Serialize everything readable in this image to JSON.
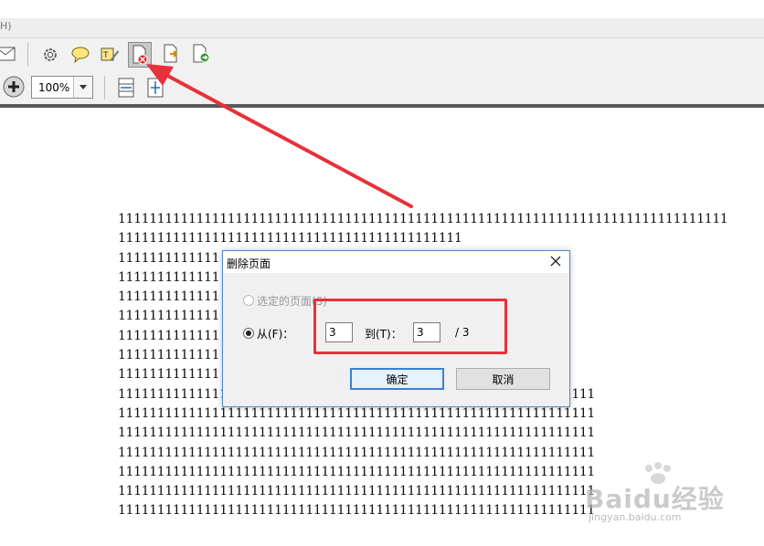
{
  "menubar": {
    "fragment": "H)"
  },
  "toolbar": {
    "zoom_value": "100%",
    "icons": [
      "mail-icon",
      "gear-icon",
      "comment-icon",
      "sign-icon",
      "delete-page-icon",
      "export-icon",
      "extract-icon",
      "zoom-in-icon",
      "fit-width-icon",
      "fit-page-icon"
    ]
  },
  "document": {
    "lines": [
      "111111111111111111111111111111111111111111111111111111111111111111111111111111",
      "11111111111111111111111111111111111111111111",
      "1111111111111",
      "1111111111111",
      "1111111111111",
      "1111111111111",
      "1111111111111",
      "1111111111111",
      "1111111111111",
      "1111111111111111111111111111111111111111111111111111111111111",
      "1111111111111111111111111111111111111111111111111111111111111",
      "1111111111111111111111111111111111111111111111111111111111111",
      "1111111111111111111111111111111111111111111111111111111111111",
      "1111111111111111111111111111111111111111111111111111111111111",
      "1111111111111111111111111111111111111111111111111111111111111",
      "1111111111111111111111111111111111111111111111111111111111111"
    ]
  },
  "dialog": {
    "title": "删除页面",
    "option_selected": "选定的页面(S)",
    "option_from": "从(F)：",
    "from_value": "3",
    "to_label": "到(T)：",
    "to_value": "3",
    "total": "/ 3",
    "ok_label": "确定",
    "cancel_label": "取消"
  },
  "watermark": {
    "main": "Baidu经验",
    "sub": "jingyan.baidu.com"
  },
  "colors": {
    "highlight": "#e8313a",
    "dialog_border": "#4f88c8",
    "ok_border": "#3b80d4"
  }
}
